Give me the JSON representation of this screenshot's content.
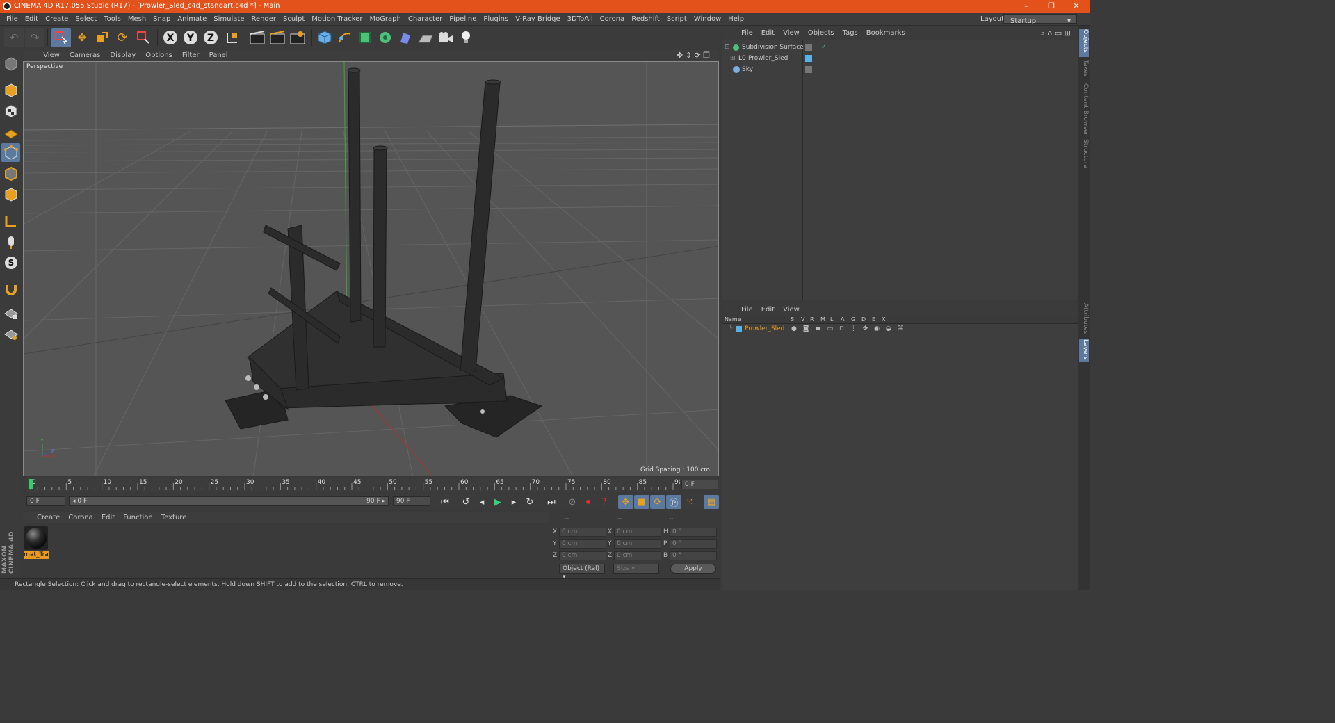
{
  "window": {
    "title": "CINEMA 4D R17.055 Studio (R17) - [Prowler_Sled_c4d_standart.c4d *] - Main",
    "minimize": "–",
    "maximize": "❐",
    "close": "✕"
  },
  "menubar": {
    "items": [
      "File",
      "Edit",
      "Create",
      "Select",
      "Tools",
      "Mesh",
      "Snap",
      "Animate",
      "Simulate",
      "Render",
      "Sculpt",
      "Motion Tracker",
      "MoGraph",
      "Character",
      "Pipeline",
      "Plugins",
      "V-Ray Bridge",
      "3DToAll",
      "Corona",
      "Redshift",
      "Script",
      "Window",
      "Help"
    ],
    "layout_label": "Layout:",
    "layout_value": "Startup"
  },
  "toolbar": {
    "axis_x": "X",
    "axis_y": "Y",
    "axis_z": "Z"
  },
  "viewport": {
    "menu": [
      "View",
      "Cameras",
      "Display",
      "Options",
      "Filter",
      "Panel"
    ],
    "label": "Perspective",
    "grid_spacing": "Grid Spacing : 100 cm",
    "axis_x": "X",
    "axis_y": "Y",
    "axis_z": "Z"
  },
  "timeline": {
    "ticks": [
      "0",
      "5",
      "10",
      "15",
      "20",
      "25",
      "30",
      "35",
      "40",
      "45",
      "50",
      "55",
      "60",
      "65",
      "70",
      "75",
      "80",
      "85",
      "90"
    ],
    "current_frame": "0 F",
    "start_field": "0 F",
    "range_start": "◂ 0 F",
    "range_end": "90 F ▸",
    "end_field": "90 F"
  },
  "material_manager": {
    "menu": [
      "Create",
      "Corona",
      "Edit",
      "Function",
      "Texture"
    ],
    "material_label": "mat_Tra"
  },
  "coordinates": {
    "header": [
      "--",
      "--",
      "--"
    ],
    "rows": [
      {
        "l1": "X",
        "v1": "0 cm",
        "l2": "X",
        "v2": "0 cm",
        "l3": "H",
        "v3": "0 °"
      },
      {
        "l1": "Y",
        "v1": "0 cm",
        "l2": "Y",
        "v2": "0 cm",
        "l3": "P",
        "v3": "0 °"
      },
      {
        "l1": "Z",
        "v1": "0 cm",
        "l2": "Z",
        "v2": "0 cm",
        "l3": "B",
        "v3": "0 °"
      }
    ],
    "mode": "Object (Rel)",
    "size": "Size",
    "apply": "Apply"
  },
  "status": "Rectangle Selection: Click and drag to rectangle-select elements. Hold down SHIFT to add to the selection, CTRL to remove.",
  "object_manager": {
    "menu": [
      "File",
      "Edit",
      "View",
      "Objects",
      "Tags",
      "Bookmarks"
    ],
    "objects": [
      "Subdivision Surface",
      "Prowler_Sled",
      "Sky"
    ]
  },
  "layer_manager": {
    "menu": [
      "File",
      "Edit",
      "View"
    ],
    "columns": [
      "Name",
      "S",
      "V",
      "R",
      "M",
      "L",
      "A",
      "G",
      "D",
      "E",
      "X"
    ],
    "layers": [
      "Prowler_Sled"
    ]
  },
  "side_tabs": [
    "Objects",
    "Takes",
    "Content Browser",
    "Structure",
    "Attributes",
    "Layers"
  ],
  "colors": {
    "titlebar": "#e2521a",
    "accent": "#5c7aa0",
    "layer_text": "#e89a1e"
  }
}
